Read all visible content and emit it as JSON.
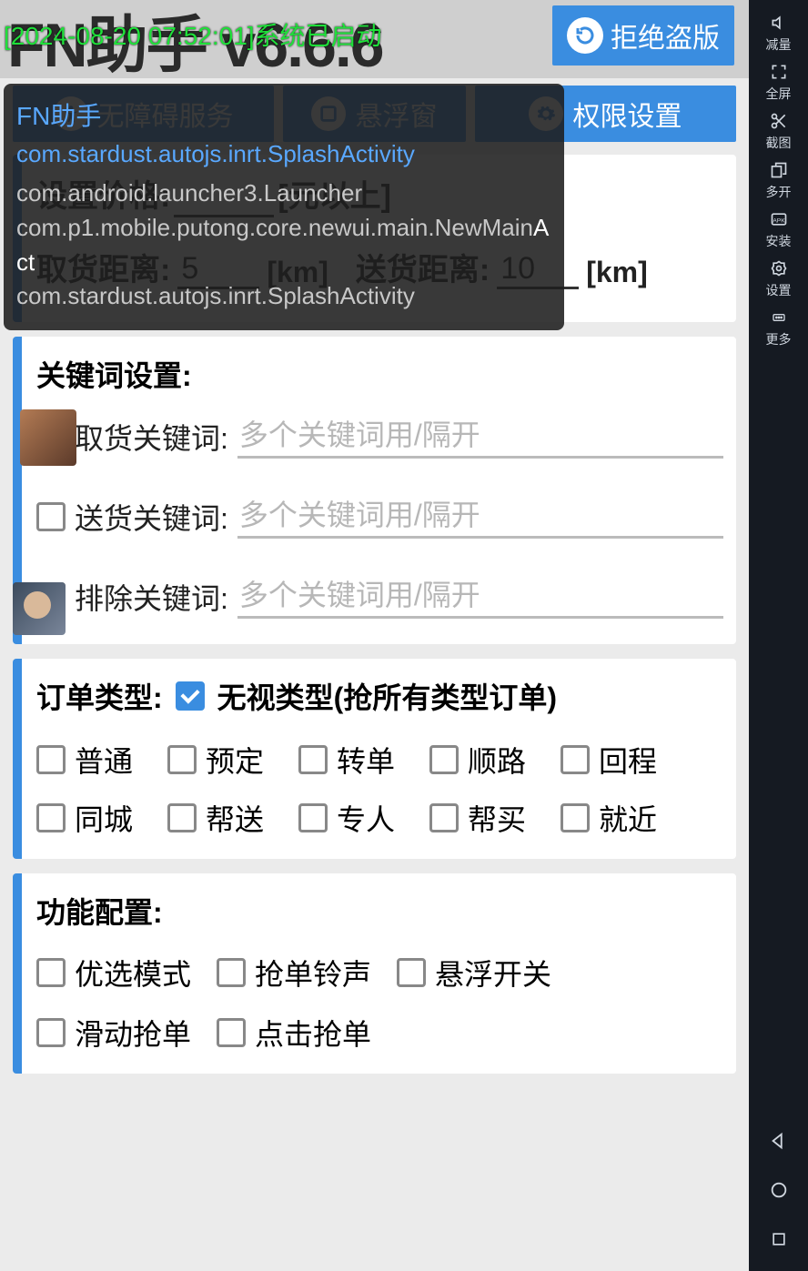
{
  "toast": "[2024-08-20 07:52:01]系统已启动",
  "header": {
    "title": "FN助手   v6.6.6",
    "reject_label": "拒绝盗版"
  },
  "topbuttons": {
    "accessibility": "无障碍服务",
    "float": "悬浮窗",
    "perm": "权限设置"
  },
  "card_price": {
    "title": "设置价格:",
    "price_value": "",
    "unit": "[元以上]",
    "pickup_label": "取货距离:",
    "pickup_value": "5",
    "km1": "[km]",
    "deliver_label": "送货距离:",
    "deliver_value": "10",
    "km2": "[km]"
  },
  "card_kw": {
    "heading": "关键词设置:",
    "pick_label": "取货关键词:",
    "deliver_label": "送货关键词:",
    "exclude_label": "排除关键词:",
    "placeholder": "多个关键词用/隔开"
  },
  "card_type": {
    "title": "订单类型:",
    "ignore_label": "无视类型(抢所有类型订单)",
    "opts": [
      "普通",
      "预定",
      "转单",
      "顺路",
      "回程",
      "同城",
      "帮送",
      "专人",
      "帮买",
      "就近"
    ]
  },
  "card_func": {
    "title": "功能配置:",
    "opts": [
      "优选模式",
      "抢单铃声",
      "悬浮开关",
      "滑动抢单",
      "点击抢单"
    ]
  },
  "overlay": {
    "title": "FN助手",
    "pkgline": "com.stardust.autojs.inrt.SplashActivity",
    "l1": "com.android.launcher3.Launcher",
    "l2a": "com.p1.mobile.putong.core.newui.main.NewMain",
    "l2b": "Act",
    "l3": "com.stardust.autojs.inrt.SplashActivity"
  },
  "sidebar": {
    "items": [
      {
        "label": "减量",
        "icon": "volume-down"
      },
      {
        "label": "全屏",
        "icon": "fullscreen"
      },
      {
        "label": "截图",
        "icon": "scissors"
      },
      {
        "label": "多开",
        "icon": "multi"
      },
      {
        "label": "安装",
        "icon": "apk"
      },
      {
        "label": "设置",
        "icon": "gear"
      },
      {
        "label": "更多",
        "icon": "more"
      }
    ]
  }
}
